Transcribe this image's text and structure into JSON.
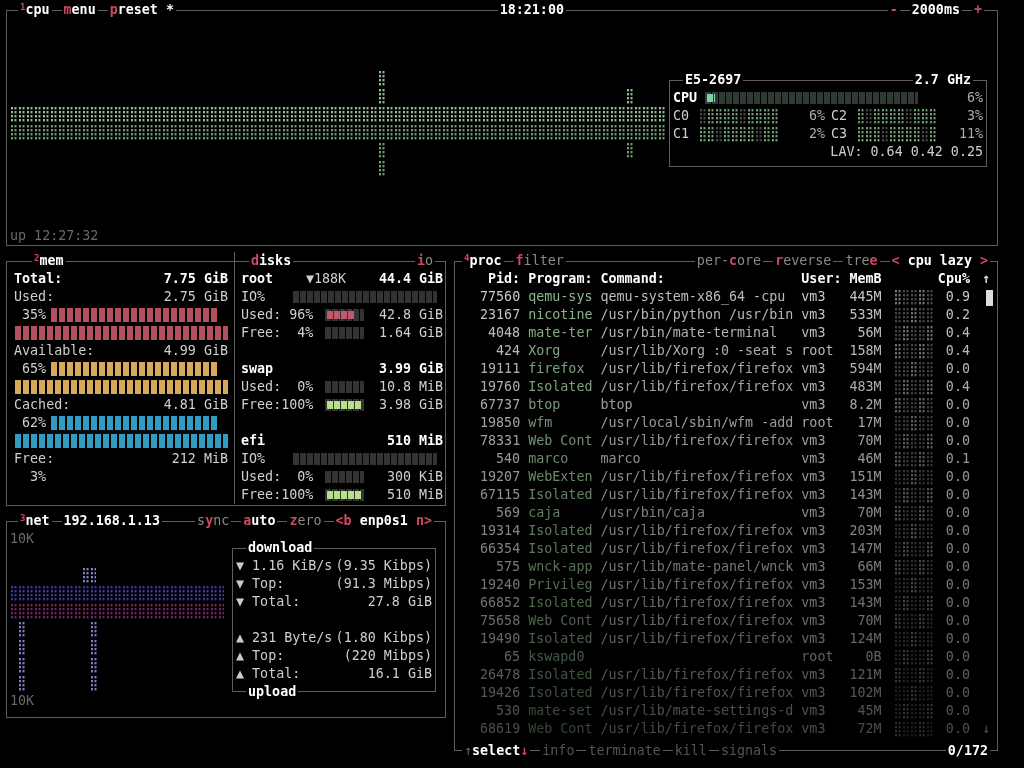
{
  "cpu_box": {
    "title": "$^{1}$cpu",
    "menu": {
      "key": "m",
      "post": "enu"
    },
    "preset": {
      "key": "p",
      "post": "reset *"
    },
    "clock": "18:21:00",
    "interval_minus": "-",
    "interval": "2000ms",
    "interval_plus": "+",
    "uptime": "up 12:27:32",
    "cpu_info": {
      "model": "E5-2697",
      "frequency": "2.7 GHz",
      "total": {
        "label": "CPU",
        "level": 0.04,
        "reading": "6%"
      },
      "cores": [
        {
          "label": "C0",
          "reading": "6%"
        },
        {
          "label": "C2",
          "reading": "3%"
        },
        {
          "label": "C1",
          "reading": "2%"
        },
        {
          "label": "C3",
          "reading": "11%"
        }
      ],
      "load_avg": "LAV: 0.64 0.42 0.25"
    }
  },
  "mem_box": {
    "title": "$^{2}$mem",
    "total": {
      "label": "Total:",
      "value": "7.75 GiB"
    },
    "stats": [
      {
        "label": "Used:",
        "value": "2.75 GiB",
        "percent": "35%",
        "color": "#b4505f"
      },
      {
        "label": "Available:",
        "value": "4.99 GiB",
        "percent": "65%",
        "color": "#d6a85a"
      },
      {
        "label": "Cached:",
        "value": "4.81 GiB",
        "percent": "62%",
        "color": "#2f9cc4"
      },
      {
        "label": "Free:",
        "value": "212 MiB",
        "percent": "3%"
      }
    ]
  },
  "disks_box": {
    "title": {
      "key": "d",
      "post": "isks"
    },
    "io": {
      "key": "i",
      "post": "o"
    },
    "disks": [
      {
        "name": "root",
        "io_rate": "▼188K",
        "size": "44.4 GiB",
        "rows": [
          {
            "kind": "io",
            "label": "IO%",
            "level": 0
          },
          {
            "kind": "used",
            "label": "Used:",
            "percent": "96%",
            "level": 0.8,
            "value": "42.8 GiB"
          },
          {
            "kind": "free",
            "label": "Free:",
            "percent": "4%",
            "level": 0,
            "value": "1.64 GiB"
          }
        ]
      },
      {
        "name": "swap",
        "size": "3.99 GiB",
        "rows": [
          {
            "kind": "used",
            "label": "Used:",
            "percent": "0%",
            "level": 0,
            "value": "10.8 MiB"
          },
          {
            "kind": "free",
            "label": "Free:",
            "percent": "100%",
            "level": 1,
            "value": "3.98 GiB"
          }
        ]
      },
      {
        "name": "efi",
        "size": "510 MiB",
        "rows": [
          {
            "kind": "io",
            "label": "IO%",
            "level": 0
          },
          {
            "kind": "used",
            "label": "Used:",
            "percent": "0%",
            "level": 0,
            "value": "300 KiB"
          },
          {
            "kind": "free",
            "label": "Free:",
            "percent": "100%",
            "level": 1,
            "value": "510 MiB"
          }
        ]
      }
    ]
  },
  "net_box": {
    "title": "$^{3}$net",
    "address": "192.168.1.13",
    "toggles": [
      {
        "pre": "s",
        "key": "y",
        "post": "nc",
        "on": false
      },
      {
        "key": "a",
        "post": "uto",
        "on": true
      },
      {
        "key": "z",
        "post": "ero",
        "on": false
      }
    ],
    "prev": "<b",
    "interface": "enp0s1",
    "next": "n>",
    "scale_top": "10K",
    "scale_bottom": "10K",
    "download": {
      "title": "download",
      "rows": [
        {
          "arrow": "▼",
          "label": "1.16 KiB/s",
          "value": "(9.35 Kibps)"
        },
        {
          "arrow": "▼",
          "label": "Top:",
          "value": "(91.3 Mibps)"
        },
        {
          "arrow": "▼",
          "label": "Total:",
          "value": "27.8 GiB"
        }
      ]
    },
    "upload": {
      "title": "upload",
      "rows": [
        {
          "arrow": "▲",
          "label": "231 Byte/s",
          "value": "(1.80 Kibps)"
        },
        {
          "arrow": "▲",
          "label": "Top:",
          "value": "(220 Mibps)"
        },
        {
          "arrow": "▲",
          "label": "Total:",
          "value": "16.1 GiB"
        }
      ]
    }
  },
  "proc_box": {
    "title": "$^{4}$proc",
    "filter": {
      "key": "f",
      "post": "ilter"
    },
    "options": [
      {
        "pre": "per-",
        "key": "c",
        "post": "ore",
        "on": false
      },
      {
        "key": "r",
        "post": "everse",
        "on": false
      },
      {
        "pre": "tre",
        "key": "e",
        "on": false
      }
    ],
    "sort_prev": "<",
    "sort": "cpu lazy",
    "sort_next": ">",
    "columns": [
      "Pid:",
      "Program:",
      "Command:",
      "User:",
      "MemB",
      "Cpu%"
    ],
    "scroll_up": "↑",
    "scroll_down": "↓",
    "rows": [
      {
        "pid": "77560",
        "program": "qemu-sys",
        "command": "qemu-system-x86_64 -cpu",
        "user": "vm3",
        "mem": "445M",
        "cpu": "0.9"
      },
      {
        "pid": "23167",
        "program": "nicotine",
        "command": "/usr/bin/python /usr/bin",
        "user": "vm3",
        "mem": "533M",
        "cpu": "0.2"
      },
      {
        "pid": "4048",
        "program": "mate-ter",
        "command": "/usr/bin/mate-terminal",
        "user": "vm3",
        "mem": "56M",
        "cpu": "0.4"
      },
      {
        "pid": "424",
        "program": "Xorg",
        "command": "/usr/lib/Xorg :0 -seat s",
        "user": "root",
        "mem": "158M",
        "cpu": "0.4"
      },
      {
        "pid": "19111",
        "program": "firefox",
        "command": "/usr/lib/firefox/firefox",
        "user": "vm3",
        "mem": "594M",
        "cpu": "0.0"
      },
      {
        "pid": "19760",
        "program": "Isolated",
        "command": "/usr/lib/firefox/firefox",
        "user": "vm3",
        "mem": "483M",
        "cpu": "0.4"
      },
      {
        "pid": "67737",
        "program": "btop",
        "command": "btop",
        "user": "vm3",
        "mem": "8.2M",
        "cpu": "0.0"
      },
      {
        "pid": "19850",
        "program": "wfm",
        "command": "/usr/local/sbin/wfm -add",
        "user": "root",
        "mem": "17M",
        "cpu": "0.0"
      },
      {
        "pid": "78331",
        "program": "Web Cont",
        "command": "/usr/lib/firefox/firefox",
        "user": "vm3",
        "mem": "70M",
        "cpu": "0.0"
      },
      {
        "pid": "540",
        "program": "marco",
        "command": "marco",
        "user": "vm3",
        "mem": "46M",
        "cpu": "0.1"
      },
      {
        "pid": "19207",
        "program": "WebExten",
        "command": "/usr/lib/firefox/firefox",
        "user": "vm3",
        "mem": "151M",
        "cpu": "0.0"
      },
      {
        "pid": "67115",
        "program": "Isolated",
        "command": "/usr/lib/firefox/firefox",
        "user": "vm3",
        "mem": "143M",
        "cpu": "0.0"
      },
      {
        "pid": "569",
        "program": "caja",
        "command": "/usr/bin/caja",
        "user": "vm3",
        "mem": "70M",
        "cpu": "0.0"
      },
      {
        "pid": "19314",
        "program": "Isolated",
        "command": "/usr/lib/firefox/firefox",
        "user": "vm3",
        "mem": "203M",
        "cpu": "0.0"
      },
      {
        "pid": "66354",
        "program": "Isolated",
        "command": "/usr/lib/firefox/firefox",
        "user": "vm3",
        "mem": "147M",
        "cpu": "0.0"
      },
      {
        "pid": "575",
        "program": "wnck-app",
        "command": "/usr/lib/mate-panel/wnck",
        "user": "vm3",
        "mem": "66M",
        "cpu": "0.0"
      },
      {
        "pid": "19240",
        "program": "Privileg",
        "command": "/usr/lib/firefox/firefox",
        "user": "vm3",
        "mem": "153M",
        "cpu": "0.0"
      },
      {
        "pid": "66852",
        "program": "Isolated",
        "command": "/usr/lib/firefox/firefox",
        "user": "vm3",
        "mem": "143M",
        "cpu": "0.0"
      },
      {
        "pid": "75658",
        "program": "Web Cont",
        "command": "/usr/lib/firefox/firefox",
        "user": "vm3",
        "mem": "70M",
        "cpu": "0.0"
      },
      {
        "pid": "19490",
        "program": "Isolated",
        "command": "/usr/lib/firefox/firefox",
        "user": "vm3",
        "mem": "124M",
        "cpu": "0.0"
      },
      {
        "pid": "65",
        "program": "kswapd0",
        "user": "root",
        "mem": "0B",
        "cpu": "0.0"
      },
      {
        "pid": "26478",
        "program": "Isolated",
        "command": "/usr/lib/firefox/firefox",
        "user": "vm3",
        "mem": "121M",
        "cpu": "0.0"
      },
      {
        "pid": "19426",
        "program": "Isolated",
        "command": "/usr/lib/firefox/firefox",
        "user": "vm3",
        "mem": "102M",
        "cpu": "0.0"
      },
      {
        "pid": "530",
        "program": "mate-set",
        "command": "/usr/lib/mate-settings-d",
        "user": "vm3",
        "mem": "45M",
        "cpu": "0.0"
      },
      {
        "pid": "68619",
        "program": "Web Cont",
        "command": "/usr/lib/firefox/firefox",
        "user": "vm3",
        "mem": "72M",
        "cpu": "0.0"
      }
    ],
    "footer": {
      "up": "↑",
      "select": "select",
      "down": "↓",
      "actions": [
        {
          "label": "info",
          "disabled": true
        },
        {
          "label": "terminate",
          "disabled": true
        },
        {
          "label": "kill",
          "disabled": true
        },
        {
          "label": "signals",
          "disabled": true
        }
      ],
      "count": "0/172"
    }
  }
}
